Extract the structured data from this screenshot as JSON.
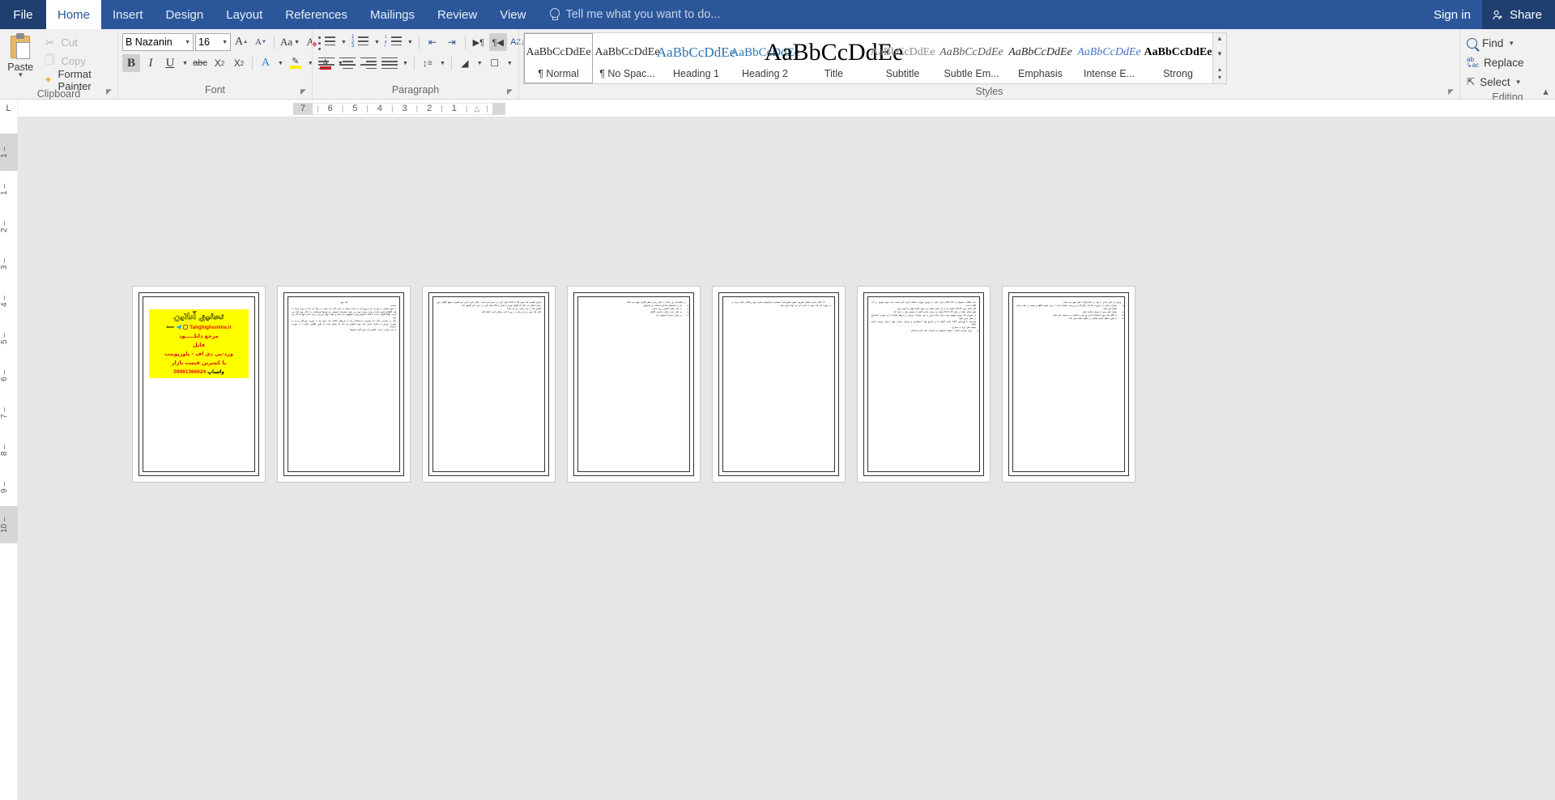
{
  "titlebar": {
    "file_tab": "File",
    "tabs": [
      "Home",
      "Insert",
      "Design",
      "Layout",
      "References",
      "Mailings",
      "Review",
      "View"
    ],
    "active_tab": "Home",
    "tellme_placeholder": "Tell me what you want to do...",
    "sign_in": "Sign in",
    "share": "Share",
    "accent_color": "#2b579a",
    "file_tab_color": "#1e3f6f"
  },
  "ribbon": {
    "groups": [
      {
        "name": "Clipboard",
        "label": "Clipboard"
      },
      {
        "name": "Font",
        "label": "Font"
      },
      {
        "name": "Paragraph",
        "label": "Paragraph"
      },
      {
        "name": "Styles",
        "label": "Styles"
      },
      {
        "name": "Editing",
        "label": "Editing"
      }
    ],
    "clipboard": {
      "paste": "Paste",
      "cut": "Cut",
      "copy": "Copy",
      "format_painter": "Format Painter"
    },
    "font": {
      "font_name": "B Nazanin",
      "font_size": "16",
      "grow_font": "A",
      "shrink_font": "A",
      "change_case": "Aa",
      "clear_formatting": "A",
      "bold": "B",
      "italic": "I",
      "underline": "U",
      "strikethrough": "abc",
      "subscript": "X",
      "superscript": "X",
      "text_effects": "A",
      "highlight_color": "#ffeb00",
      "font_color": "#e81123",
      "bold_active": true
    },
    "styles": {
      "items": [
        {
          "preview": "AaBbCcDdEe",
          "name": "¶ Normal",
          "selected": true,
          "color": "#2a2a2a",
          "size": "14px",
          "style": "normal",
          "weight": "normal"
        },
        {
          "preview": "AaBbCcDdEe",
          "name": "¶ No Spac...",
          "selected": false,
          "color": "#2a2a2a",
          "size": "14px",
          "style": "normal",
          "weight": "normal"
        },
        {
          "preview": "AaBbCcDdEe",
          "name": "Heading 1",
          "selected": false,
          "color": "#2e74b5",
          "size": "17px",
          "style": "normal",
          "weight": "normal"
        },
        {
          "preview": "AaBbCcDdEe",
          "name": "Heading 2",
          "selected": false,
          "color": "#2e74b5",
          "size": "15px",
          "style": "normal",
          "weight": "normal"
        },
        {
          "preview": "AaBbCcDdEe",
          "name": "Title",
          "selected": false,
          "color": "#000000",
          "size": "30px",
          "style": "normal",
          "weight": "normal"
        },
        {
          "preview": "AaBbCcDdEe",
          "name": "Subtitle",
          "selected": false,
          "color": "#8c8c8c",
          "size": "14px",
          "style": "normal",
          "weight": "normal"
        },
        {
          "preview": "AaBbCcDdEe",
          "name": "Subtle Em...",
          "selected": false,
          "color": "#5a5a5a",
          "size": "14px",
          "style": "italic",
          "weight": "normal"
        },
        {
          "preview": "AaBbCcDdEe",
          "name": "Emphasis",
          "selected": false,
          "color": "#2a2a2a",
          "size": "14px",
          "style": "italic",
          "weight": "normal"
        },
        {
          "preview": "AaBbCcDdEe",
          "name": "Intense E...",
          "selected": false,
          "color": "#4472c4",
          "size": "14px",
          "style": "italic",
          "weight": "normal"
        },
        {
          "preview": "AaBbCcDdEe",
          "name": "Strong",
          "selected": false,
          "color": "#000000",
          "size": "14px",
          "style": "normal",
          "weight": "bold"
        }
      ]
    },
    "editing": {
      "find": "Find",
      "replace": "Replace",
      "select": "Select"
    }
  },
  "ruler": {
    "corner_tab": "L",
    "horizontal_marks": [
      "7",
      "6",
      "5",
      "4",
      "3",
      "2",
      "1"
    ],
    "vertical_marks": [
      "1",
      "1",
      "2",
      "3",
      "4",
      "5",
      "6",
      "7",
      "8",
      "9",
      "10"
    ]
  },
  "document": {
    "view": "multiple-pages",
    "pages": [
      {
        "index": 1,
        "type": "cover",
        "cover": {
          "title_fa": "تحقیق آنلاین",
          "site": "Tahghighonline.ir",
          "line2": "مرجع دانلـــــود",
          "line3": "فایل",
          "line4": "ورد-پی دی اف - پاورپوینت",
          "line5": "با کمترین قیمت بازار",
          "phone": "09981366624",
          "whatsapp": "واتساپ",
          "bg_color": "#ffff00",
          "text_color": "#e01010"
        }
      },
      {
        "index": 2,
        "type": "text",
        "heading": "قند خون",
        "subheading": "مقدمه :",
        "paragraphs": [
          "به طور طبیعی با خوردن غذا و ورود آن به معده، هضم در معده آغاز می شود. به دنبال آن غذا در روده باریک به قند (گلوکز) تجزیه شده و وارد جریان خون می شود. همزمان انسولین نیز توسط لوزالمعده به داخل خون آزاد می گردد. نهایتاً گلوکز یا قند با کمک انسولین وارد سلولهای بدن شده و جهت تولید انرژی و زنده ماندن آنها به کار می رود.",
          "حال در مواردی مانند غذا نخوردن و استفاده زیاد از داروهای کاهنده قند خون چه به صورت خوراکی و چه به صورت تزریقی در افراد دیابتی، قند خون کاهش می یابد که ممکن است به طور ناگهانی باشد یا به صورت تدریجی.",
          "به چه میزانی از قند، کاهش قند خون گفته میشود؟"
        ]
      },
      {
        "index": 3,
        "type": "text",
        "paragraphs": [
          "میزان طبیعی قند خون 70 تا 110 میلی گرم در دسی لیتر است. علائم پایین آمدن غیر طبیعی سطح گلوکز خون زمانی اتفاق می افتد که گلوکز خون به کمتر از 60 میلی گرم در دسی لیتر کاهش یابد.",
          "کاهش قند در چه زمانی رخ می دهد؟",
          "افت قند خون در هر زمانی از روز یا شب ممکن است اتفاق افتد."
        ]
      },
      {
        "index": 4,
        "type": "text",
        "paragraphs": [
          "در سالمندان این حادثه به دلیل زیادی خطر نگرانی مهم می باشد."
        ],
        "bullets": [
          "اثر از ساختمان شانس استفاده از انسولین",
          "به علت نظم نداشتن رژیم غذایی",
          "به علت عدم دریافت مناسب گلوکز",
          "در میزان تحرک انسولین کرد"
        ]
      },
      {
        "index": 5,
        "type": "text",
        "heading": "-3 علائم عصبی شامل تشریج، تشنج، تشنج قند، عصبانیت، فراموشی شدن، بهم ریختگی، باشد برنده و",
        "paragraphs": [
          "در موارد نادر قند خون به اندازه ای می تواند پایین بیاید."
        ]
      },
      {
        "index": 6,
        "type": "text",
        "paragraphs": [
          "عدد شکلات معمولی یا 3-2 قالب چای عمل به مریض خوراند. اضافه کردن لازم نیست قند میوه موجود در آب کافی است.",
          "اگر علائم برای 15-10 دقیقه بعد از آن ادامه داشته می توان اقدام فوق را تکرار نمود.",
          "نظر داشته باشد در طی 30 تا 60 دقیقه بعد وعده غذایی کامل یا مختصر میل را میل کند.",
          "در صورتی که مریض بیهوش بوده مرکز تماید چیزی به وی خوراند، مریض را به پهلو خواباند تا در صورت استفراغ از دهان خارج شود.",
          "همزمان با اورژانس 155 تماس گرفته تا در اسرع وقت آمبولانس و پرسنل درمانی جهت درمان مریض اعزام شوند."
        ],
        "footer_heading": "توصیه های لازم به بیماران :",
        "bullets": [
          "برای بیماران دیابتی ( بقسم انسولین می گیرند) عمل کردن مختصر"
        ]
      },
      {
        "index": 7,
        "type": "text",
        "paragraphs": [
          "وجود ریا غذای قندی با خود در تمام اوقات غیلی مهم می باشد."
        ],
        "bullets": [
          "بیماران دیابتی از ضرورت ها باید برگرداندن و بررسی میشل دارند، ( برای نمونه کیکها و بعضی از نمک درمان اتفاق مای افتد.",
          "همراه تلفن خود را همراه داشته باشد،",
          "از الکل قند خون معاشنک کردن ورزش و فعالیت به سنجیده مای قایی",
          "به طور منظم انجام مشکل در تنظیم نشانه های افت."
        ]
      }
    ]
  }
}
